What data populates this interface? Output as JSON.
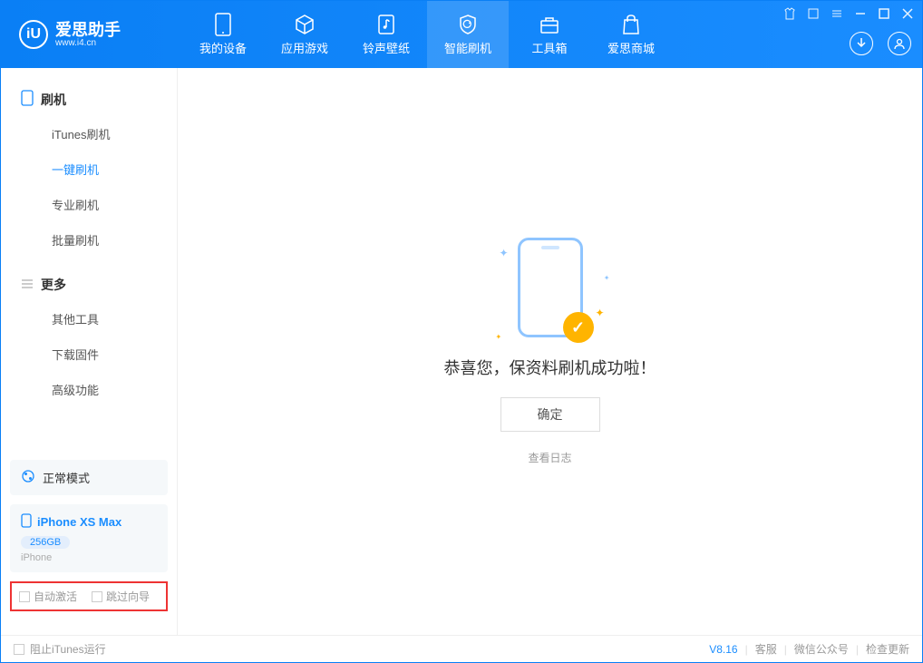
{
  "app": {
    "name": "爱思助手",
    "url": "www.i4.cn"
  },
  "nav": {
    "tabs": [
      {
        "label": "我的设备"
      },
      {
        "label": "应用游戏"
      },
      {
        "label": "铃声壁纸"
      },
      {
        "label": "智能刷机"
      },
      {
        "label": "工具箱"
      },
      {
        "label": "爱思商城"
      }
    ]
  },
  "sidebar": {
    "section1": {
      "title": "刷机",
      "items": [
        "iTunes刷机",
        "一键刷机",
        "专业刷机",
        "批量刷机"
      ]
    },
    "section2": {
      "title": "更多",
      "items": [
        "其他工具",
        "下载固件",
        "高级功能"
      ]
    },
    "mode": "正常模式",
    "device": {
      "name": "iPhone XS Max",
      "storage": "256GB",
      "type": "iPhone"
    },
    "checkboxes": {
      "auto_activate": "自动激活",
      "skip_guide": "跳过向导"
    }
  },
  "main": {
    "success_message": "恭喜您，保资料刷机成功啦！",
    "ok_button": "确定",
    "view_log": "查看日志"
  },
  "footer": {
    "block_itunes": "阻止iTunes运行",
    "version": "V8.16",
    "links": [
      "客服",
      "微信公众号",
      "检查更新"
    ]
  }
}
